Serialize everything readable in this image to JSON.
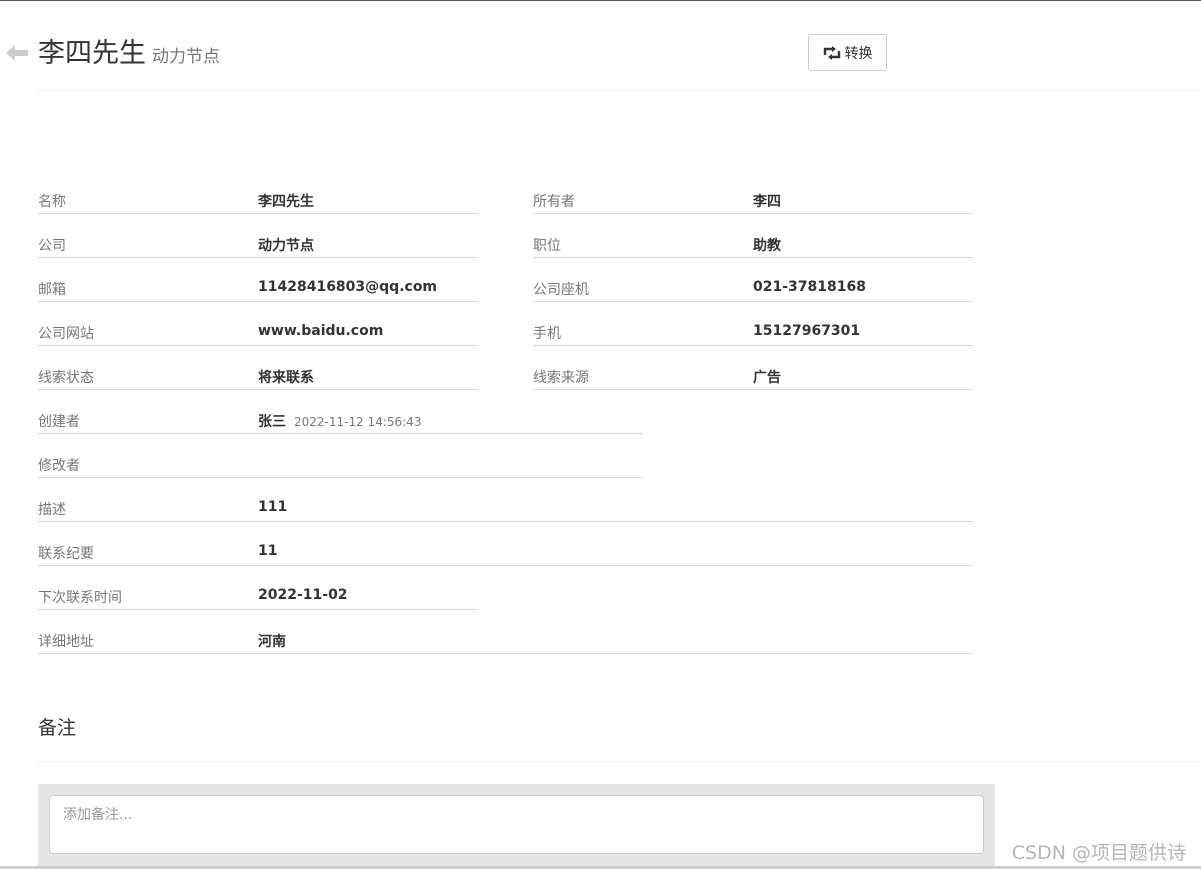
{
  "header": {
    "title": "李四先生",
    "subtitle": "动力节点",
    "convert_label": "转换",
    "back_icon": "arrow-left-icon",
    "convert_icon": "retweet-icon"
  },
  "fields": {
    "name": {
      "label": "名称",
      "value": "李四先生"
    },
    "owner": {
      "label": "所有者",
      "value": "李四"
    },
    "company": {
      "label": "公司",
      "value": "动力节点"
    },
    "job": {
      "label": "职位",
      "value": "助教"
    },
    "email": {
      "label": "邮箱",
      "value": "11428416803@qq.com"
    },
    "company_phone": {
      "label": "公司座机",
      "value": "021-37818168"
    },
    "website": {
      "label": "公司网站",
      "value": "www.baidu.com"
    },
    "mobile": {
      "label": "手机",
      "value": "15127967301"
    },
    "clue_state": {
      "label": "线索状态",
      "value": "将来联系"
    },
    "source": {
      "label": "线索来源",
      "value": "广告"
    },
    "create_by": {
      "label": "创建者",
      "value": "张三",
      "time": "2022-11-12 14:56:43"
    },
    "edit_by": {
      "label": "修改者",
      "value": ""
    },
    "description": {
      "label": "描述",
      "value": "111"
    },
    "contact_summary": {
      "label": "联系纪要",
      "value": "11"
    },
    "next_contact_time": {
      "label": "下次联系时间",
      "value": "2022-11-02"
    },
    "address": {
      "label": "详细地址",
      "value": "河南"
    }
  },
  "notes": {
    "heading": "备注",
    "placeholder": "添加备注..."
  },
  "watermark": "CSDN @项目题供诗",
  "colors": {
    "label": "#777777",
    "value": "#333333",
    "divider": "#d6d6d6",
    "panel": "#e6e6e6"
  }
}
